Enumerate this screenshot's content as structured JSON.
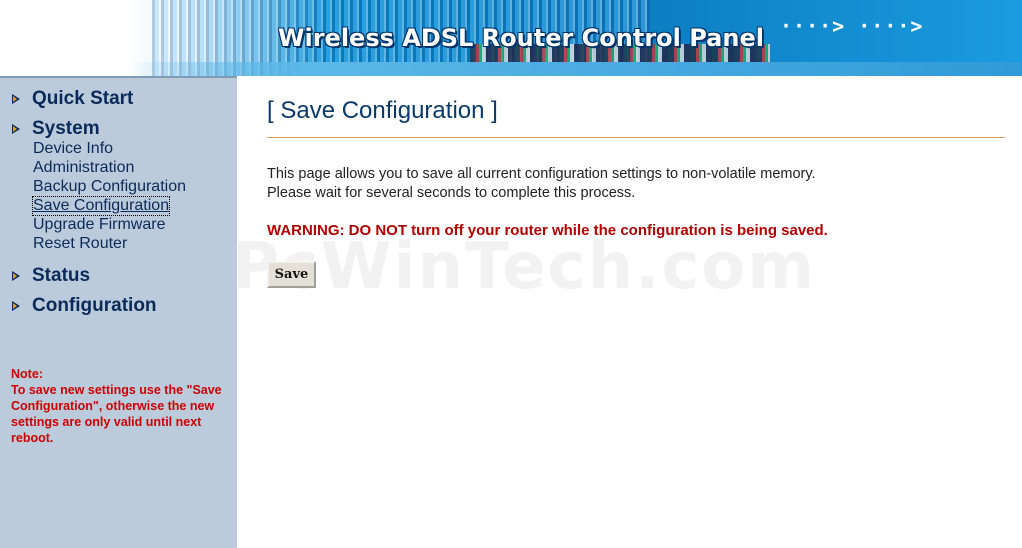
{
  "banner": {
    "title": "Wireless ADSL Router Control Panel",
    "arrows": "····> ····>"
  },
  "sidebar": {
    "sections": [
      {
        "label": "Quick Start"
      },
      {
        "label": "System",
        "items": [
          "Device Info",
          "Administration",
          "Backup Configuration",
          "Save Configuration",
          "Upgrade Firmware",
          "Reset Router"
        ]
      },
      {
        "label": "Status"
      },
      {
        "label": "Configuration"
      }
    ],
    "active_item": "Save Configuration",
    "note": "Note:\nTo save new settings use the \"Save Configuration\", otherwise the new settings are only valid until next reboot."
  },
  "main": {
    "title": "[ Save Configuration ]",
    "description": "This page allows you to save all current configuration settings to non-volatile memory.  Please wait for several seconds to complete this process.",
    "warning": "WARNING: DO NOT turn off your router while the configuration is being saved.",
    "save_label": "Save"
  },
  "watermark": "PcWinTech.com",
  "colors": {
    "sidebar_bg": "#bccbdb",
    "nav_text": "#0a2a5a",
    "title_text": "#0a3a6a",
    "warning_text": "#b00000",
    "note_text": "#cc0000",
    "rule": "#e0a050"
  }
}
